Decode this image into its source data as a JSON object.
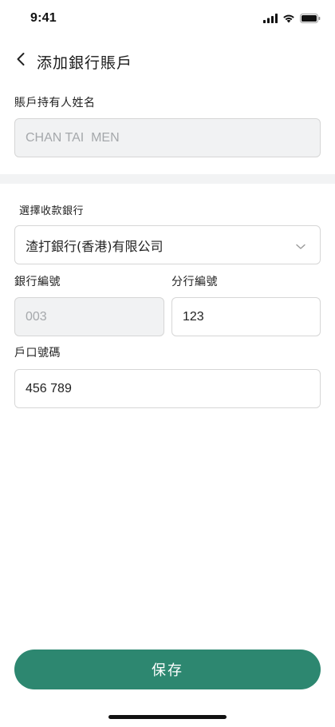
{
  "status_bar": {
    "time": "9:41",
    "icons": [
      "cellular-signal-icon",
      "wifi-icon",
      "battery-icon"
    ]
  },
  "header": {
    "back_icon": "chevron-left-icon",
    "title": "添加銀行賬戶"
  },
  "account_holder": {
    "label": "賬戶持有人姓名",
    "value": "CHAN TAI  MEN"
  },
  "bank_select": {
    "label": "選擇收款銀行",
    "value": "渣打銀行(香港)有限公司",
    "icon": "chevron-down-icon"
  },
  "bank_code": {
    "label": "銀行編號",
    "value": "003"
  },
  "branch_code": {
    "label": "分行編號",
    "value": "123"
  },
  "account_number": {
    "label": "戶口號碼",
    "value": "456 789"
  },
  "save_button": {
    "label": "保存"
  },
  "colors": {
    "primary": "#2d8770",
    "disabled_bg": "#f1f2f3",
    "disabled_text": "#a5a8ab",
    "border": "#d6d6d6"
  }
}
